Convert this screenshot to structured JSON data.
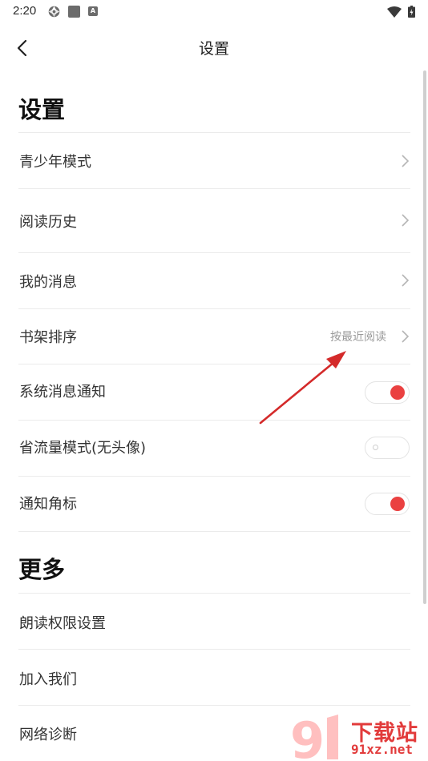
{
  "status_bar": {
    "time": "2:20",
    "icons": [
      "aperture-icon",
      "square-icon",
      "a-badge-icon",
      "wifi-icon",
      "battery-icon"
    ],
    "a_badge": "A"
  },
  "nav": {
    "title": "设置",
    "back_icon": "chevron-left-icon"
  },
  "sections": {
    "settings_heading": "设置",
    "more_heading": "更多"
  },
  "settings": {
    "teen_mode": "青少年模式",
    "reading_history": "阅读历史",
    "my_messages": "我的消息",
    "shelf_sort": "书架排序",
    "shelf_sort_value": "按最近阅读",
    "system_notify": "系统消息通知",
    "system_notify_on": true,
    "data_saver": "省流量模式(无头像)",
    "data_saver_on": false,
    "badge_notify": "通知角标",
    "badge_notify_on": true
  },
  "more": {
    "read_aloud_permission": "朗读权限设置",
    "join_us": "加入我们",
    "network_diagnosis": "网络诊断"
  },
  "watermark": {
    "logo_text": "下载站",
    "url": "91xz.net"
  },
  "colors": {
    "accent": "#ea4141",
    "annotation_arrow": "#d42a2a",
    "divider": "#ebebeb"
  }
}
